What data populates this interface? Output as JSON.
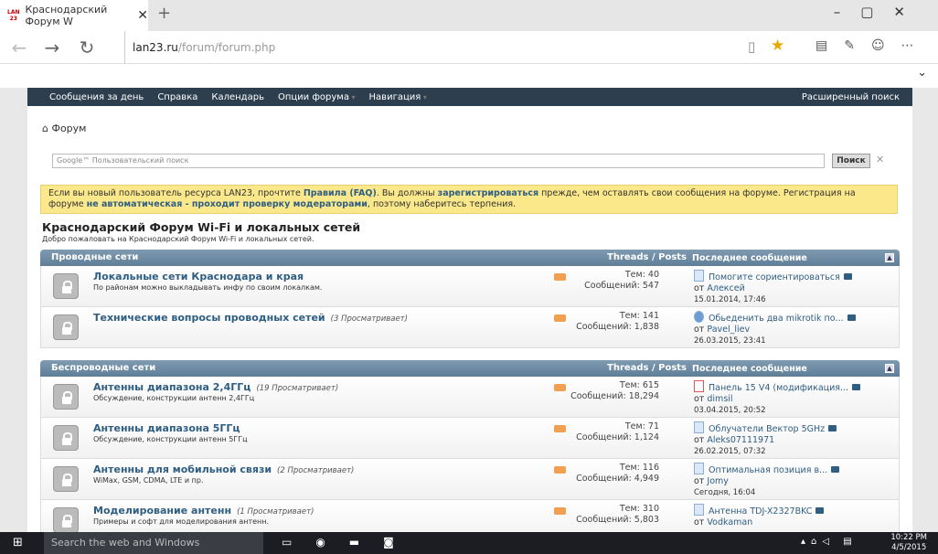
{
  "browser": {
    "tab_title": "Краснодарский Форум W",
    "url_domain": "lan23.ru",
    "url_path": "/forum/forum.php"
  },
  "nav": {
    "items": [
      "Сообщения за день",
      "Справка",
      "Календарь",
      "Опции форума",
      "Навигация"
    ],
    "right": "Расширенный поиск"
  },
  "breadcrumb": "Форум",
  "search": {
    "placeholder": "Google™ Пользовательский поиск",
    "button": "Поиск"
  },
  "notice": {
    "p1": "Если вы новый пользователь ресурса LAN23, прочтите ",
    "l1": "Правила (FAQ)",
    "p2": ". Вы должны ",
    "l2": "зарегистрироваться",
    "p3": " прежде, чем оставлять свои сообщения на форуме. Регистрация на форуме ",
    "l3": "не автоматическая - проходит проверку модераторами",
    "p4": ", поэтому наберитесь терпения."
  },
  "forum": {
    "title": "Краснодарский Форум Wi-Fi и локальных сетей",
    "subtitle": "Добро пожаловать на Краснодарский Форум Wi-Fi и локальных сетей."
  },
  "sections": [
    {
      "name": "Проводные сети",
      "threads_posts": "Threads / Posts",
      "last": "Последнее сообщение",
      "rows": [
        {
          "title": "Локальные сети Краснодара и края",
          "viewing": "",
          "desc": "По районам можно выкладывать инфу по своим локалкам.",
          "threads": "Тем: 40",
          "posts": "Сообщений: 547",
          "last_title": "Помогите сориентироваться",
          "last_by": "Алексей",
          "last_date": "15.01.2014, 17:46"
        },
        {
          "title": "Технические вопросы проводных сетей",
          "viewing": "(3 Просматривает)",
          "desc": "",
          "threads": "Тем: 141",
          "posts": "Сообщений: 1,838",
          "last_title": "Обьеденить два mikrotik по...",
          "last_by": "Pavel_liev",
          "last_date": "26.03.2015, 23:41"
        }
      ]
    },
    {
      "name": "Беспроводные сети",
      "threads_posts": "Threads / Posts",
      "last": "Последнее сообщение",
      "rows": [
        {
          "title": "Антенны диапазона 2,4ГГц",
          "viewing": "(19 Просматривает)",
          "desc": "Обсуждение, конструкции антенн 2,4ГГц",
          "threads": "Тем: 615",
          "posts": "Сообщений: 18,294",
          "last_title": "Панель 15 V4 (модификация...",
          "last_by": "dimsil",
          "last_date": "03.04.2015, 20:52"
        },
        {
          "title": "Антенны диапазона 5ГГц",
          "viewing": "",
          "desc": "Обсуждение, конструкции антенн 5ГГц",
          "threads": "Тем: 71",
          "posts": "Сообщений: 1,124",
          "last_title": "Облучатели Вектор 5GHz",
          "last_by": "Aleks07111971",
          "last_date": "26.02.2015, 07:32"
        },
        {
          "title": "Антенны для мобильной связи",
          "viewing": "(2 Просматривает)",
          "desc": "WiMax, GSM, CDMA, LTE и пр.",
          "threads": "Тем: 116",
          "posts": "Сообщений: 4,949",
          "last_title": "Оптимальная позиция в...",
          "last_by": "Jomy",
          "last_date": "Сегодня, 16:04"
        },
        {
          "title": "Моделирование антенн",
          "viewing": "(1 Просматривает)",
          "desc": "Примеры и софт для моделирования антенн.",
          "threads": "Тем: 310",
          "posts": "Сообщений: 5,803",
          "last_title": "Антенна TDJ-X2327BKC",
          "last_by": "Vodkaman",
          "last_date": ""
        }
      ]
    }
  ],
  "by_prefix": "от",
  "taskbar": {
    "search": "Search the web and Windows",
    "time": "10:22 PM",
    "date": "4/5/2015"
  }
}
